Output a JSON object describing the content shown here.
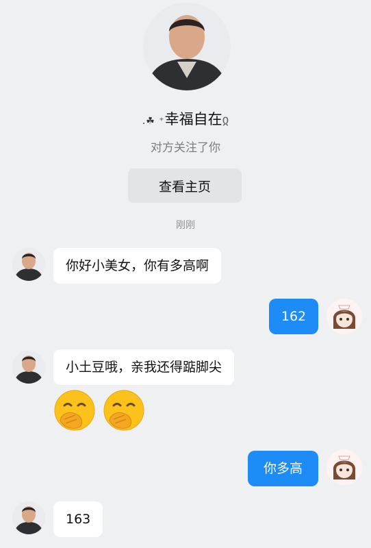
{
  "profile": {
    "name_prefix": ".☘ ⁺",
    "name": "幸福自在",
    "name_suffix": "ჲ",
    "follow_note": "对方关注了你",
    "view_homepage_label": "查看主页"
  },
  "timestamp": "刚刚",
  "messages": [
    {
      "side": "left",
      "text": "你好小美女，你有多高啊"
    },
    {
      "side": "right",
      "text": "162"
    },
    {
      "side": "left",
      "text": "小土豆哦，亲我还得踮脚尖"
    },
    {
      "side": "left",
      "emoji": "face-with-hand-over-mouth",
      "count": 2
    },
    {
      "side": "right",
      "text": "你多高"
    },
    {
      "side": "left",
      "text": "163"
    }
  ],
  "colors": {
    "background": "#eff0f2",
    "outgoing_bubble": "#1e8cf6",
    "incoming_bubble": "#ffffff"
  }
}
